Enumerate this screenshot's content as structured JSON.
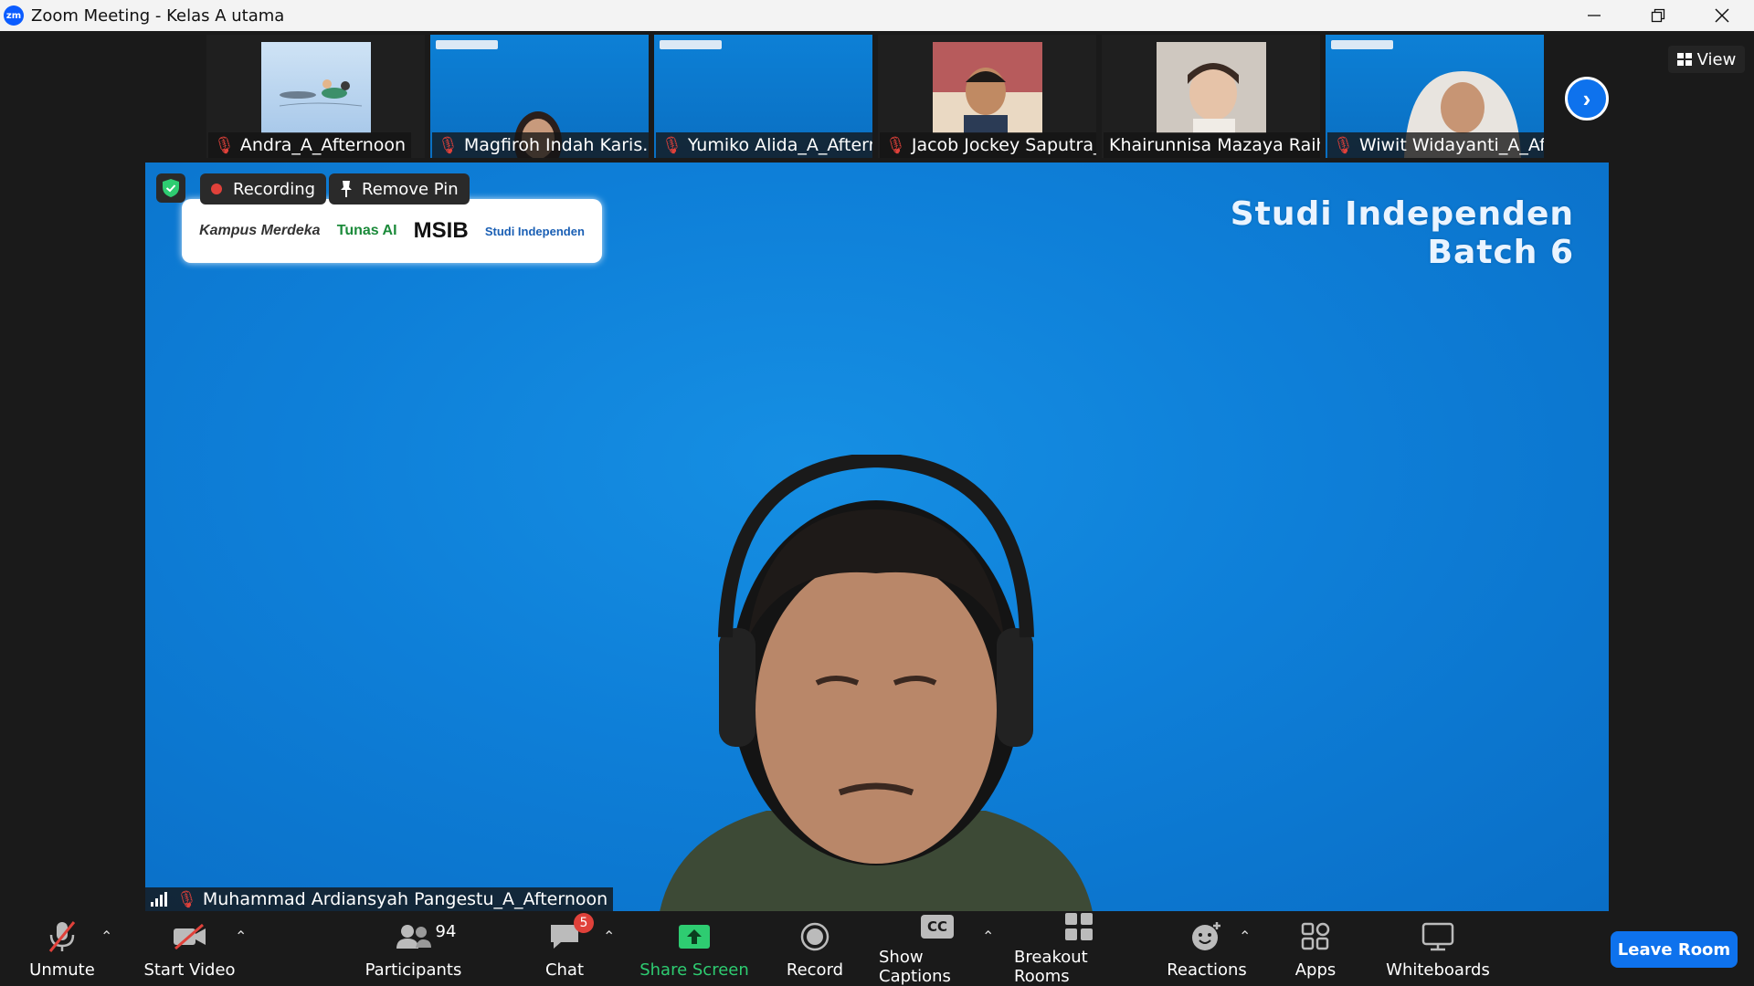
{
  "window": {
    "app_icon_text": "zm",
    "title": "Zoom Meeting - Kelas A utama"
  },
  "thumbnails": [
    {
      "name": "Andra_A_Afternoon"
    },
    {
      "name": "Magfiroh Indah Karis..."
    },
    {
      "name": "Yumiko Alida_A_Aftern..."
    },
    {
      "name": "Jacob Jockey Saputra_..."
    },
    {
      "name": "Khairunnisa Mazaya Raih..."
    },
    {
      "name": "Wiwit Widayanti_A_Aft..."
    }
  ],
  "view_button": {
    "label": "View"
  },
  "main": {
    "recording_label": "Recording",
    "remove_pin_label": "Remove Pin",
    "background_heading_line1": "Studi Independen",
    "background_heading_line2": "Batch 6",
    "logos": [
      "Kampus Merdeka",
      "Tunas AI",
      "MSIB",
      "Studi Independen"
    ],
    "speaker_name": "Muhammad Ardiansyah Pangestu_A_Afternoon"
  },
  "toolbar": {
    "unmute": "Unmute",
    "start_video": "Start Video",
    "participants": "Participants",
    "participants_count": "94",
    "chat": "Chat",
    "chat_badge": "5",
    "share_screen": "Share Screen",
    "record": "Record",
    "show_captions": "Show Captions",
    "captions_icon_text": "CC",
    "breakout_rooms": "Breakout Rooms",
    "reactions": "Reactions",
    "apps": "Apps",
    "whiteboards": "Whiteboards",
    "leave_room": "Leave Room"
  },
  "colors": {
    "accent": "#0e72ed",
    "muted_red": "#e0413a",
    "share_green": "#2ecc71",
    "background_blue": "#0e7fd8"
  }
}
